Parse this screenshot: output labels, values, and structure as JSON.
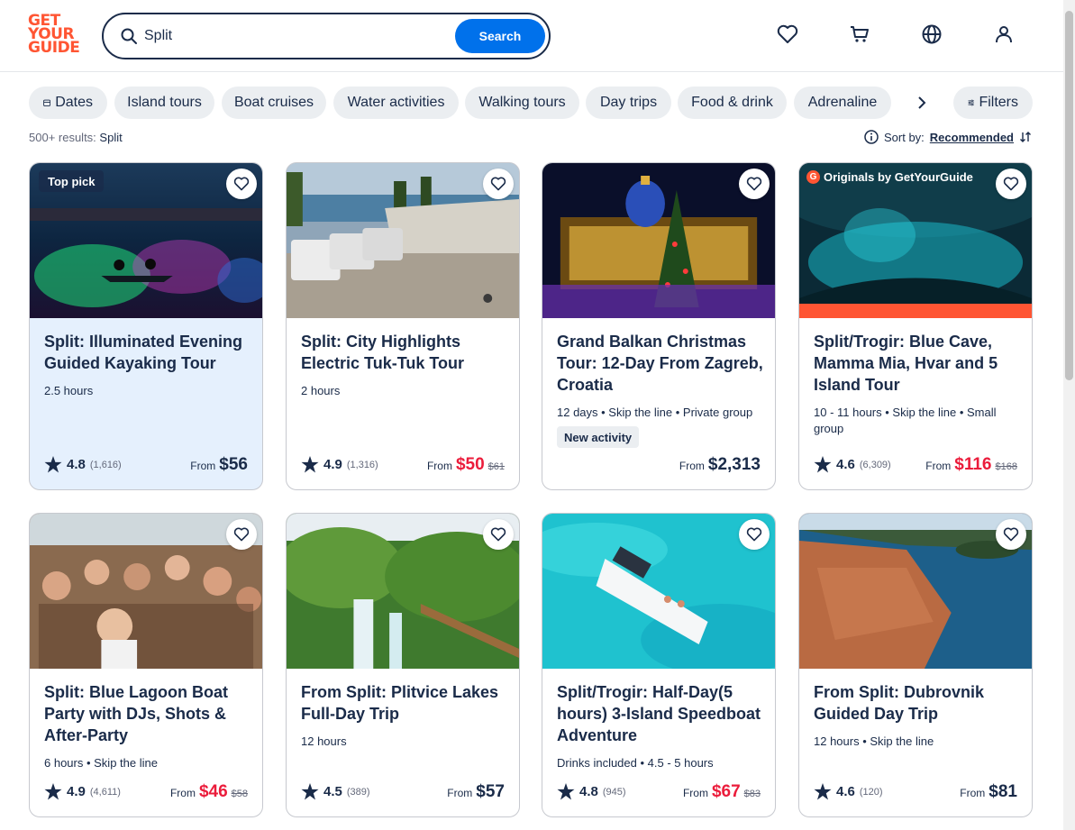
{
  "logo": {
    "lines": [
      "GET",
      "YOUR",
      "GUIDE"
    ]
  },
  "search": {
    "value": "Split",
    "button_label": "Search"
  },
  "filters": {
    "chips": [
      "Dates",
      "Island tours",
      "Boat cruises",
      "Water activities",
      "Walking tours",
      "Day trips",
      "Food & drink",
      "Adrenaline"
    ],
    "filters_label": "Filters"
  },
  "results": {
    "count": "500+ results:",
    "query": "Split"
  },
  "sort": {
    "label": "Sort by:",
    "value": "Recommended"
  },
  "cards": [
    {
      "badge": "Top pick",
      "title": "Split: Illuminated Evening Guided Kayaking Tour",
      "meta": "2.5 hours",
      "rating": "4.8",
      "reviews": "(1,616)",
      "from": "From",
      "price": "$56",
      "old_price": ""
    },
    {
      "badge": "",
      "title": "Split: City Highlights Electric Tuk-Tuk Tour",
      "meta": "2 hours",
      "rating": "4.9",
      "reviews": "(1,316)",
      "from": "From",
      "price": "$50",
      "old_price": "$61"
    },
    {
      "badge": "",
      "title": "Grand Balkan Christmas Tour: 12-Day From Zagreb, Croatia",
      "meta": "12 days • Skip the line • Private group",
      "new_label": "New activity",
      "rating": "",
      "reviews": "",
      "from": "From",
      "price": "$2,313",
      "old_price": ""
    },
    {
      "badge": "Originals by GetYourGuide",
      "badge_letter": "G",
      "title": "Split/Trogir: Blue Cave, Mamma Mia, Hvar and 5 Island Tour",
      "meta": "10 - 11 hours • Skip the line • Small group",
      "rating": "4.6",
      "reviews": "(6,309)",
      "from": "From",
      "price": "$116",
      "old_price": "$168"
    },
    {
      "badge": "",
      "title": "Split: Blue Lagoon Boat Party with DJs, Shots & After-Party",
      "meta": "6 hours • Skip the line",
      "rating": "4.9",
      "reviews": "(4,611)",
      "from": "From",
      "price": "$46",
      "old_price": "$58"
    },
    {
      "badge": "",
      "title": "From Split: Plitvice Lakes Full-Day Trip",
      "meta": "12 hours",
      "rating": "4.5",
      "reviews": "(389)",
      "from": "From",
      "price": "$57",
      "old_price": ""
    },
    {
      "badge": "",
      "title": "Split/Trogir: Half-Day(5 hours) 3-Island Speedboat Adventure",
      "meta": "Drinks included • 4.5 - 5 hours",
      "rating": "4.8",
      "reviews": "(945)",
      "from": "From",
      "price": "$67",
      "old_price": "$83"
    },
    {
      "badge": "",
      "title": "From Split: Dubrovnik Guided Day Trip",
      "meta": "12 hours • Skip the line",
      "rating": "4.6",
      "reviews": "(120)",
      "from": "From",
      "price": "$81",
      "old_price": ""
    }
  ],
  "colors": {
    "brand": "#ff5533",
    "accent": "#0071eb",
    "sale": "#eb1c3b",
    "text": "#1a2b49"
  }
}
